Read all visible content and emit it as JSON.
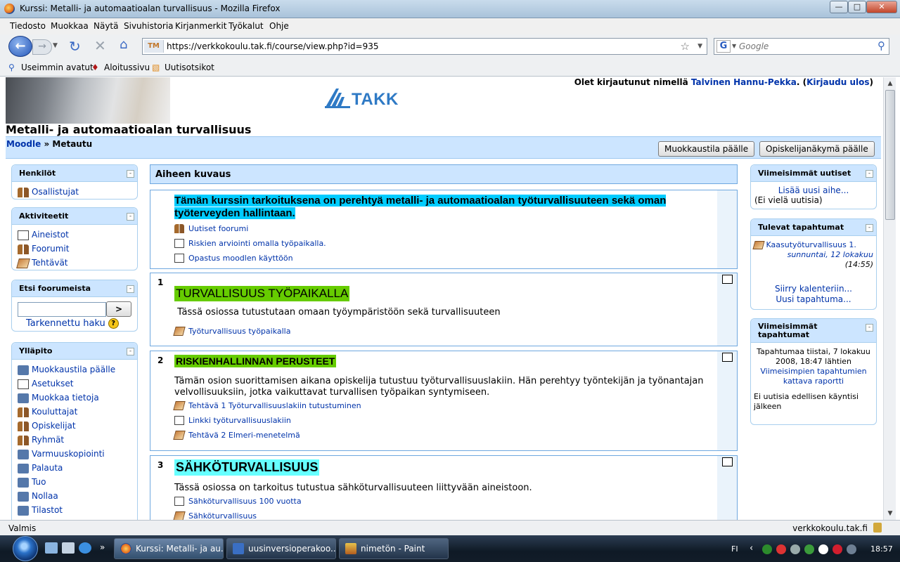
{
  "window": {
    "title": "Kurssi: Metalli- ja automaatioalan turvallisuus - Mozilla Firefox",
    "minimize": "—",
    "maximize": "□",
    "close": "✕"
  },
  "menu": [
    "Tiedosto",
    "Muokkaa",
    "Näytä",
    "Sivuhistoria",
    "Kirjanmerkit",
    "Työkalut",
    "Ohje"
  ],
  "nav": {
    "url": "https://verkkokoulu.tak.fi/course/view.php?id=935",
    "search_placeholder": "Google",
    "search_engine": "G"
  },
  "bookmarks": [
    "Useimmin avatut",
    "Aloitussivu",
    "Uutisotsikot"
  ],
  "header": {
    "logo": "TAKK",
    "login_prefix": "Olet kirjautunut nimellä ",
    "user_name": "Talvinen Hannu-Pekka",
    "logout": "Kirjaudu ulos",
    "course_title": "Metalli- ja automaatioalan turvallisuus",
    "breadcrumb_home": "Moodle",
    "breadcrumb_sep": " » ",
    "breadcrumb_current": "Metautu",
    "edit_on_button": "Muokkaustila päälle",
    "student_view_button": "Opiskelijanäkymä päälle"
  },
  "left_blocks": {
    "people": {
      "title": "Henkilöt",
      "items": [
        "Osallistujat"
      ]
    },
    "activities": {
      "title": "Aktiviteetit",
      "items": [
        "Aineistot",
        "Foorumit",
        "Tehtävät"
      ]
    },
    "search": {
      "title": "Etsi foorumeista",
      "go": ">",
      "advanced": "Tarkennettu haku",
      "help": "?"
    },
    "admin": {
      "title": "Ylläpito",
      "items": [
        "Muokkaustila päälle",
        "Asetukset",
        "Muokkaa tietoja",
        "Kouluttajat",
        "Opiskelijat",
        "Ryhmät",
        "Varmuuskopiointi",
        "Palauta",
        "Tuo",
        "Nollaa",
        "Tilastot"
      ]
    }
  },
  "center": {
    "topic_header": "Aiheen kuvaus",
    "intro": {
      "text": "Tämän kurssin tarkoituksena on perehtyä metalli- ja automaatioalan työturvallisuuteen sekä oman työterveyden hallintaan.",
      "activities": [
        "Uutiset foorumi",
        "Riskien arviointi omalla työpaikalla.",
        "Opastus moodlen käyttöön"
      ]
    },
    "sections": [
      {
        "num": "1",
        "title": "TURVALLISUUS TYÖPAIKALLA",
        "title_bg": "#66cc00",
        "desc": " Tässä osiossa tutustutaan omaan työympäristöön sekä turvallisuuteen",
        "activities": [
          "Työturvallisuus työpaikalla"
        ]
      },
      {
        "num": "2",
        "title": "RISKIENHALLINNAN PERUSTEET",
        "title_bg": "#66cc00",
        "desc": "Tämän osion suorittamisen aikana opiskelija tutustuu työturvallisuuslakiin. Hän perehtyy työntekijän ja työnantajan velvollisuuksiin, jotka vaikuttavat turvallisen työpaikan syntymiseen.",
        "activities": [
          "Tehtävä 1 Työturvallisuuslakiin tutustuminen",
          "Linkki työturvallisuuslakiin",
          "Tehtävä 2 Elmeri-menetelmä"
        ]
      },
      {
        "num": "3",
        "title": "SÄHKÖTURVALLISUUS",
        "title_bg": "#66ffff",
        "desc": "Tässä osiossa on tarkoitus tutustua sähköturvallisuuteen liittyvään aineistoon.",
        "activities": [
          "Sähköturvallisuus 100 vuotta",
          "Sähköturvallisuus"
        ]
      }
    ],
    "intro_bg": "#00ccff"
  },
  "right_blocks": {
    "news": {
      "title": "Viimeisimmät uutiset",
      "add": "Lisää uusi aihe...",
      "empty": "(Ei vielä uutisia)"
    },
    "upcoming": {
      "title": "Tulevat tapahtumat",
      "event": "Kaasutyöturvallisuus 1.",
      "date": "sunnuntai, 12 lokakuu",
      "time": "(14:55)",
      "calendar": "Siirry kalenteriin...",
      "new_event": "Uusi tapahtuma..."
    },
    "recent": {
      "title": "Viimeisimmät tapahtumat",
      "since": "Tapahtumaa tiistai, 7 lokakuu 2008, 18:47 lähtien",
      "report": "Viimeisimpien tapahtumien kattava raportti",
      "none": "Ei uutisia edellisen käyntisi jälkeen"
    }
  },
  "status": {
    "left": "Valmis",
    "right": "verkkokoulu.tak.fi"
  },
  "taskbar": {
    "buttons": [
      "Kurssi: Metalli- ja au...",
      "uusinversioperakoo...",
      "nimetön - Paint"
    ],
    "lang": "FI",
    "clock": "18:57"
  }
}
